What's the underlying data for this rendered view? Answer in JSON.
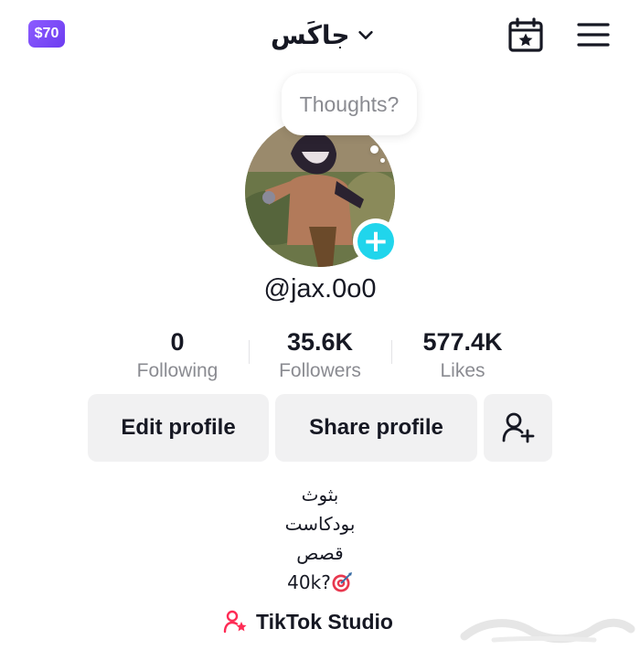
{
  "header": {
    "coin_badge": "$70",
    "account_name": "جاكَس",
    "icons": [
      "chevron-down-icon",
      "calendar-star-icon",
      "hamburger-menu-icon"
    ]
  },
  "profile": {
    "thought_placeholder": "Thoughts?",
    "username": "@jax.0o0",
    "add_avatar_symbol": "+"
  },
  "stats": [
    {
      "value": "0",
      "label": "Following"
    },
    {
      "value": "35.6K",
      "label": "Followers"
    },
    {
      "value": "577.4K",
      "label": "Likes"
    }
  ],
  "actions": {
    "edit_profile": "Edit profile",
    "share_profile": "Share profile"
  },
  "bio": {
    "lines": [
      "بثوث",
      "بودكاست",
      "قصص"
    ],
    "goal_text": "40k?"
  },
  "studio": {
    "label": "TikTok Studio"
  },
  "colors": {
    "accent_cyan": "#20d5ec",
    "coin_purple": "#7a4cf5",
    "studio_pink": "#fe2c55",
    "text": "#161823",
    "muted": "#8a8b91"
  }
}
